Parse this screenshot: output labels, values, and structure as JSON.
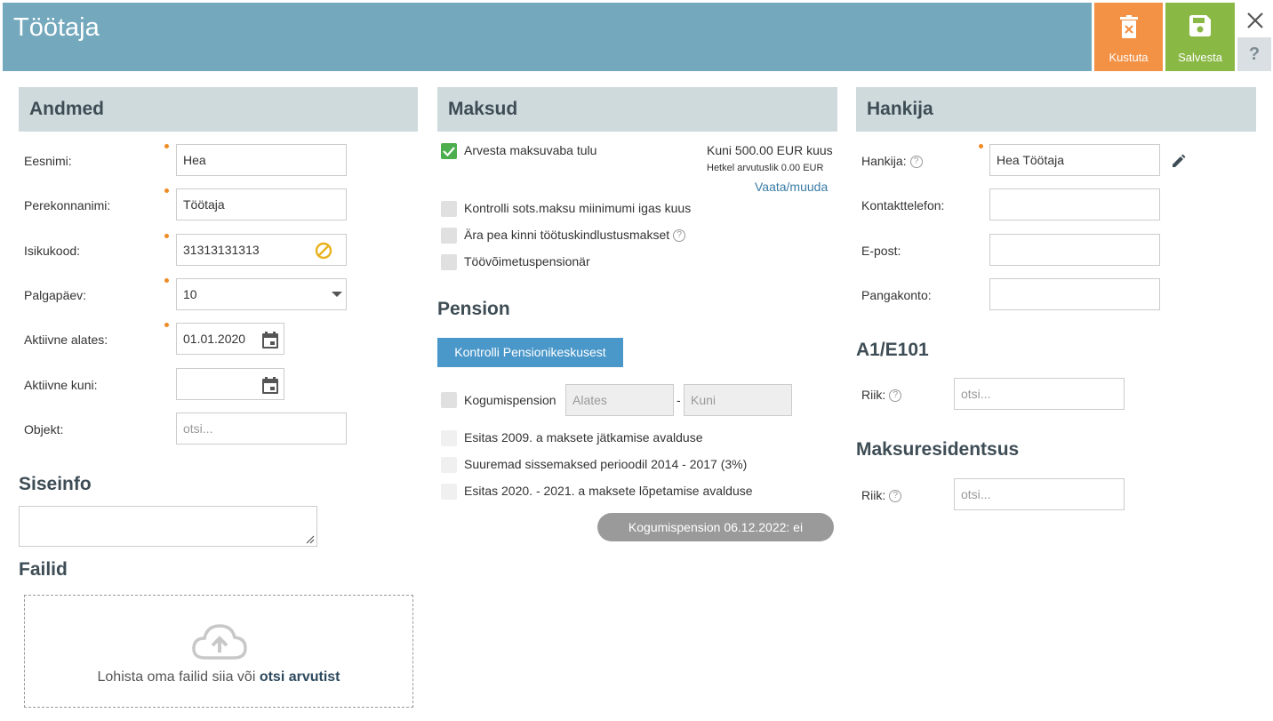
{
  "header": {
    "title": "Töötaja",
    "delete_label": "Kustuta",
    "save_label": "Salvesta",
    "help_label": "?"
  },
  "andmed": {
    "title": "Andmed",
    "first_name_label": "Eesnimi:",
    "first_name_value": "Hea",
    "last_name_label": "Perekonnanimi:",
    "last_name_value": "Töötaja",
    "id_code_label": "Isikukood:",
    "id_code_value": "31313131313",
    "payday_label": "Palgapäev:",
    "payday_value": "10",
    "active_from_label": "Aktiivne alates:",
    "active_from_value": "01.01.2020",
    "active_to_label": "Aktiivne kuni:",
    "active_to_value": "",
    "object_label": "Objekt:",
    "object_placeholder": "otsi..."
  },
  "siseinfo": {
    "title": "Siseinfo"
  },
  "failid": {
    "title": "Failid",
    "drop_text": "Lohista oma failid siia või ",
    "drop_link": "otsi arvutist"
  },
  "maksud": {
    "title": "Maksud",
    "taxfree_label": "Arvesta maksuvaba tulu",
    "taxfree_limit": "Kuni 500.00 EUR kuus",
    "taxfree_current": "Hetkel arvutuslik 0.00 EUR",
    "taxfree_link": "Vaata/muuda",
    "check_social": "Kontrolli sots.maksu miinimumi igas kuus",
    "check_unemployment": "Ära pea kinni töötuskindlustusmakset",
    "check_disability": "Töövõimetuspensionär"
  },
  "pension": {
    "title": "Pension",
    "check_button": "Kontrolli Pensionikeskusest",
    "funded_label": "Kogumispension",
    "from_placeholder": "Alates",
    "dash": "-",
    "to_placeholder": "Kuni",
    "opt_2009": "Esitas 2009. a maksete jätkamise avalduse",
    "opt_2014": "Suuremad sissemaksed perioodil 2014 - 2017 (3%)",
    "opt_2020": "Esitas 2020. - 2021. a maksete lõpetamise avalduse",
    "status_pill": "Kogumispension 06.12.2022: ei"
  },
  "hankija": {
    "title": "Hankija",
    "supplier_label": "Hankija:",
    "supplier_value": "Hea Töötaja",
    "phone_label": "Kontakttelefon:",
    "email_label": "E-post:",
    "bank_label": "Pangakonto:"
  },
  "a1": {
    "title": "A1/E101",
    "country_label": "Riik:",
    "country_placeholder": "otsi..."
  },
  "residency": {
    "title": "Maksuresidentsus",
    "country_label": "Riik:",
    "country_placeholder": "otsi..."
  }
}
